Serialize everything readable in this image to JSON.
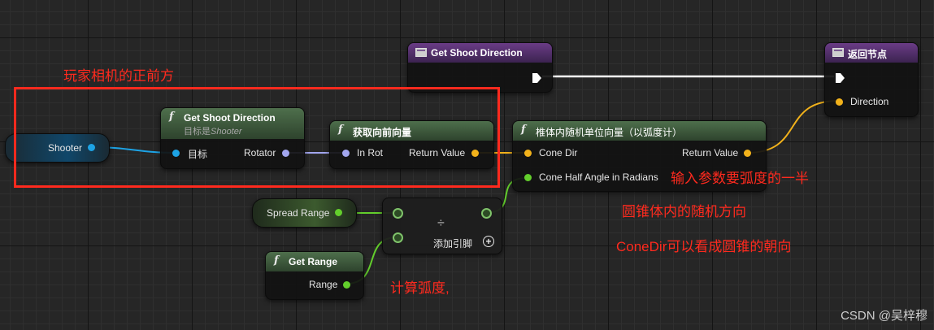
{
  "nodes": {
    "get_shoot_direction_event": {
      "title": "Get Shoot Direction"
    },
    "return_node": {
      "title": "返回节点",
      "pin_direction": "Direction"
    },
    "shooter_var": {
      "label": "Shooter"
    },
    "get_shoot_direction_fn": {
      "title": "Get Shoot Direction",
      "subtitle_prefix": "目标是",
      "subtitle_target": "Shooter",
      "pin_target": "目标",
      "pin_rotator": "Rotator"
    },
    "get_forward_vector": {
      "title": "获取向前向量",
      "pin_in": "In Rot",
      "pin_out": "Return Value"
    },
    "random_unit_vector": {
      "title": "椎体内随机单位向量（以弧度计）",
      "pin_cone_dir": "Cone Dir",
      "pin_half_angle": "Cone Half Angle in Radians",
      "pin_out": "Return Value"
    },
    "spread_range_var": {
      "label": "Spread Range"
    },
    "divide_node": {
      "symbol": "÷",
      "add_pin": "添加引脚"
    },
    "get_range_fn": {
      "title": "Get Range",
      "pin_out": "Range"
    }
  },
  "annotations": {
    "camera_forward": "玩家相机的正前方",
    "half_radian": "输入参数要弧度的一半",
    "random_dir": "圆锥体内的随机方向",
    "cone_dir_note": "ConeDir可以看成圆锥的朝向",
    "calc_radian": "计算弧度,"
  },
  "watermark": "CSDN @吴梓穆",
  "colors": {
    "highlight": "#ff2a1e",
    "object_pin": "#1da3e5",
    "rotator_pin": "#a2a6ee",
    "vector_pin": "#f2b21b",
    "float_pin": "#63ce2c",
    "function_header": "#4e6f4c",
    "event_header": "#6a3c86"
  }
}
